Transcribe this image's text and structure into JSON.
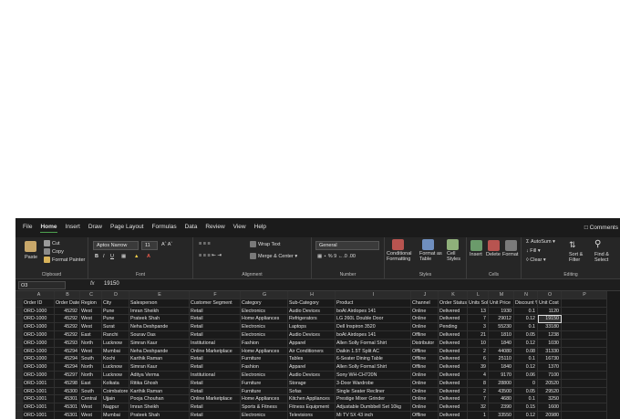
{
  "menu": [
    "File",
    "Home",
    "Insert",
    "Draw",
    "Page Layout",
    "Formulas",
    "Data",
    "Review",
    "View",
    "Help"
  ],
  "comments_label": "Comments",
  "ribbon": {
    "paste": "Paste",
    "cut": "Cut",
    "copy": "Copy",
    "format_painter": "Format Painter",
    "clipboard": "Clipboard",
    "font_name": "Aptos Narrow",
    "font_size": "11",
    "font": "Font",
    "wrap_text": "Wrap Text",
    "merge_center": "Merge & Center",
    "alignment": "Alignment",
    "number_format": "General",
    "number": "Number",
    "conditional_formatting_1": "Conditional",
    "conditional_formatting_2": "Formatting",
    "format_as_table_1": "Format as",
    "format_as_table_2": "Table",
    "cell_styles_1": "Cell",
    "cell_styles_2": "Styles",
    "styles": "Styles",
    "insert": "Insert",
    "delete": "Delete",
    "format": "Format",
    "cells": "Cells",
    "autosum": "AutoSum",
    "fill": "Fill",
    "clear": "Clear",
    "sort_filter_1": "Sort &",
    "sort_filter_2": "Filter",
    "find_select_1": "Find &",
    "find_select_2": "Select",
    "editing": "Editing"
  },
  "formula_bar": {
    "name_box": "O3",
    "fx": "fx",
    "value": "19150"
  },
  "columns": [
    "A",
    "B",
    "C",
    "D",
    "E",
    "F",
    "G",
    "H",
    "I",
    "J",
    "K",
    "L",
    "M",
    "N",
    "O",
    "P"
  ],
  "headers": [
    "Order ID",
    "Order Date",
    "Region",
    "City",
    "Salesperson",
    "Customer Segment",
    "Category",
    "Sub-Category",
    "Product",
    "Channel",
    "Order Status",
    "Units Sold",
    "Unit Price",
    "Discount %",
    "Unit Cost"
  ],
  "rows": [
    [
      "ORD-1000",
      "45292",
      "West",
      "Pune",
      "Imran Sheikh",
      "Retail",
      "Electronics",
      "Audio Devices",
      "boAt Airdopes 141",
      "Online",
      "Delivered",
      "13",
      "1930",
      "0.1",
      "1120"
    ],
    [
      "ORD-1000",
      "45292",
      "West",
      "Pune",
      "Prateek Shah",
      "Retail",
      "Home Appliances",
      "Refrigerators",
      "LG 260L Double Door",
      "Online",
      "Delivered",
      "7",
      "29012",
      "0.12",
      "19150"
    ],
    [
      "ORD-1000",
      "45292",
      "West",
      "Surat",
      "Neha Deshpande",
      "Retail",
      "Electronics",
      "Laptops",
      "Dell Inspiron 3520",
      "Online",
      "Pending",
      "3",
      "55230",
      "0.1",
      "33180"
    ],
    [
      "ORD-1000",
      "45292",
      "East",
      "Ranchi",
      "Sourav Das",
      "Retail",
      "Electronics",
      "Audio Devices",
      "boAt Airdopes 141",
      "Offline",
      "Delivered",
      "21",
      "1810",
      "0.05",
      "1238"
    ],
    [
      "ORD-1000",
      "45293",
      "North",
      "Lucknow",
      "Simran Kaur",
      "Institutional",
      "Fashion",
      "Apparel",
      "Allen Solly Formal Shirt",
      "Distributor",
      "Delivered",
      "10",
      "1840",
      "0.12",
      "1030"
    ],
    [
      "ORD-1000",
      "45294",
      "West",
      "Mumbai",
      "Neha Deshpande",
      "Online Marketplace",
      "Home Appliances",
      "Air Conditioners",
      "Daikin 1.5T Split AC",
      "Offline",
      "Delivered",
      "2",
      "44080",
      "0.08",
      "31330"
    ],
    [
      "ORD-1000",
      "45294",
      "South",
      "Kochi",
      "Karthik Raman",
      "Retail",
      "Furniture",
      "Tables",
      "6-Seater Dining Table",
      "Offline",
      "Delivered",
      "6",
      "25110",
      "0.1",
      "16730"
    ],
    [
      "ORD-1000",
      "45294",
      "North",
      "Lucknow",
      "Simran Kaur",
      "Retail",
      "Fashion",
      "Apparel",
      "Allen Solly Formal Shirt",
      "Offline",
      "Delivered",
      "39",
      "1840",
      "0.12",
      "1370"
    ],
    [
      "ORD-1000",
      "45297",
      "North",
      "Lucknow",
      "Aditya Verma",
      "Institutional",
      "Electronics",
      "Audio Devices",
      "Sony WH-CH720N",
      "Online",
      "Delivered",
      "4",
      "9170",
      "0.06",
      "7100"
    ],
    [
      "ORD-1001",
      "45298",
      "East",
      "Kolkata",
      "Ritika Ghosh",
      "Retail",
      "Furniture",
      "Storage",
      "3-Door Wardrobe",
      "Online",
      "Delivered",
      "8",
      "28800",
      "0",
      "20520"
    ],
    [
      "ORD-1001",
      "45300",
      "South",
      "Coimbatore",
      "Karthik Raman",
      "Retail",
      "Furniture",
      "Sofas",
      "Single Seater Recliner",
      "Online",
      "Delivered",
      "2",
      "43500",
      "0.05",
      "29520"
    ],
    [
      "ORD-1001",
      "45301",
      "Central",
      "Ujjain",
      "Pooja Chouhan",
      "Online Marketplace",
      "Home Appliances",
      "Kitchen Appliances",
      "Prestige Mixer Grinder",
      "Online",
      "Delivered",
      "7",
      "4680",
      "0.1",
      "3250"
    ],
    [
      "ORD-1001",
      "45301",
      "West",
      "Nagpur",
      "Imran Sheikh",
      "Retail",
      "Sports & Fitness",
      "Fitness Equipment",
      "Adjustable Dumbbell Set 10kg",
      "Online",
      "Delivered",
      "32",
      "2390",
      "0.15",
      "1600"
    ],
    [
      "ORD-1001",
      "45301",
      "West",
      "Mumbai",
      "Prateek Shah",
      "Retail",
      "Electronics",
      "Televisions",
      "Mi TV 5X 43 inch",
      "Offline",
      "Delivered",
      "1",
      "33550",
      "0.12",
      "20980"
    ]
  ]
}
